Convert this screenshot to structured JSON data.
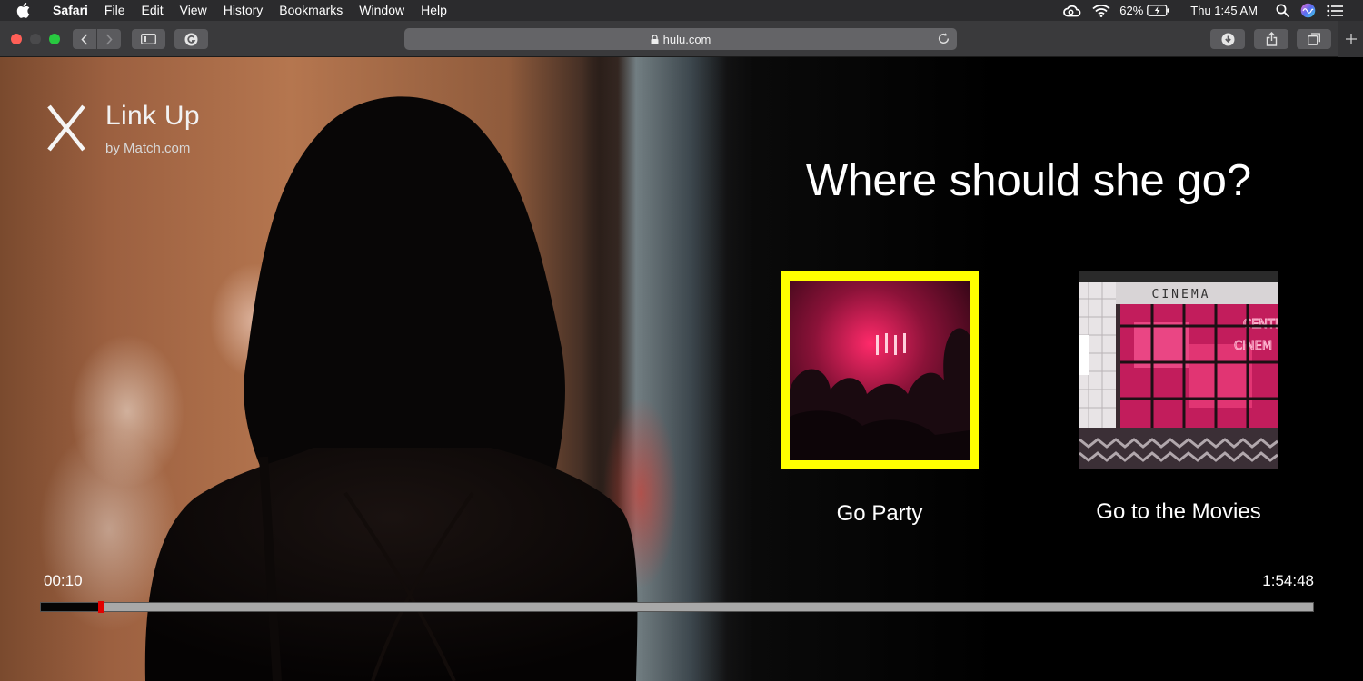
{
  "menubar": {
    "app_name": "Safari",
    "items": [
      "File",
      "Edit",
      "View",
      "History",
      "Bookmarks",
      "Window",
      "Help"
    ],
    "battery": "62%",
    "clock": "Thu 1:45 AM",
    "icons": [
      "apple-icon",
      "creative-cloud-icon",
      "wifi-icon",
      "battery-icon",
      "spotlight-icon",
      "siri-icon",
      "notification-center-icon"
    ]
  },
  "toolbar": {
    "url": "hulu.com",
    "icons": [
      "back-icon",
      "forward-icon",
      "sidebar-icon",
      "grammarly-icon",
      "lock-icon",
      "reload-icon",
      "download-icon",
      "share-icon",
      "tabs-icon",
      "new-tab-icon"
    ]
  },
  "player": {
    "brand_title": "Link Up",
    "brand_subtitle": "by Match.com",
    "question": "Where should she go?",
    "choices": [
      {
        "label": "Go Party",
        "selected": true
      },
      {
        "label": "Go to the Movies",
        "selected": false,
        "sign_text": "CINEMA"
      }
    ],
    "time_current": "00:10",
    "time_total": "1:54:48",
    "progress_fraction": 0.046,
    "colors": {
      "selection": "#ffff00",
      "playhead": "#e20000"
    }
  }
}
